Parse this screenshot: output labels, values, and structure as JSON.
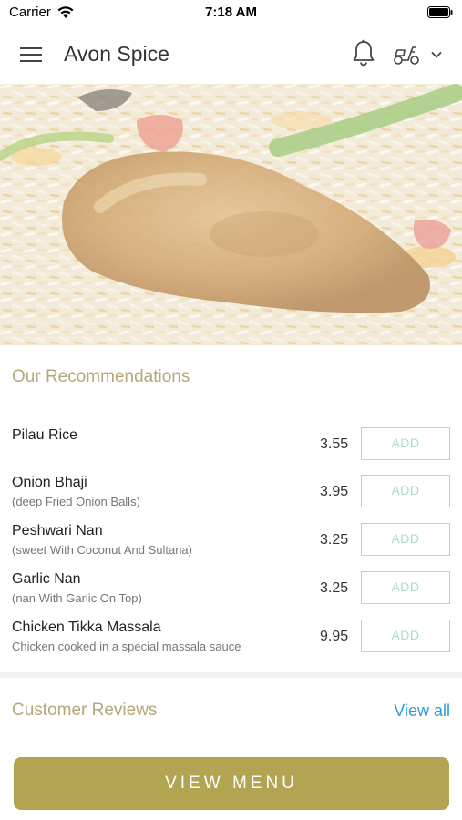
{
  "status_bar": {
    "carrier": "Carrier",
    "time": "7:18 AM"
  },
  "header": {
    "title": "Avon Spice",
    "icons": [
      "menu-icon",
      "bell-icon",
      "scooter-icon",
      "chevron-down-icon"
    ]
  },
  "recommendations": {
    "title": "Our Recommendations",
    "items": [
      {
        "name": "Pilau Rice",
        "description": "",
        "price": "3.55",
        "button": "ADD"
      },
      {
        "name": "Onion Bhaji",
        "description": "(deep Fried Onion Balls)",
        "price": "3.95",
        "button": "ADD"
      },
      {
        "name": "Peshwari Nan",
        "description": "(sweet With Coconut And Sultana)",
        "price": "3.25",
        "button": "ADD"
      },
      {
        "name": "Garlic Nan",
        "description": "(nan With Garlic On Top)",
        "price": "3.25",
        "button": "ADD"
      },
      {
        "name": "Chicken Tikka Massala",
        "description": "Chicken cooked in a special massala sauce",
        "price": "9.95",
        "button": "ADD"
      }
    ]
  },
  "reviews": {
    "title": "Customer Reviews",
    "view_all": "View all"
  },
  "footer": {
    "view_menu": "VIEW MENU"
  },
  "colors": {
    "accent_gold": "#b3a452",
    "section_title": "#b4a77a",
    "add_button": "#a6dccc",
    "link_blue": "#2e9ed6"
  }
}
